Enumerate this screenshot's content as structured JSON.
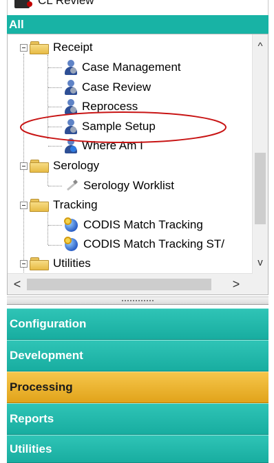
{
  "top_item": {
    "label": "CL Review"
  },
  "group_header": {
    "label": "All"
  },
  "tree": {
    "items": [
      {
        "label": "Receipt",
        "icon": "folder-icon"
      },
      {
        "label": "Case Management",
        "icon": "user-icon"
      },
      {
        "label": "Case Review",
        "icon": "user-icon"
      },
      {
        "label": "Reprocess",
        "icon": "user-icon"
      },
      {
        "label": "Sample Setup",
        "icon": "user-icon"
      },
      {
        "label": "Where Am I",
        "icon": "user-info-icon"
      },
      {
        "label": "Serology",
        "icon": "folder-icon"
      },
      {
        "label": "Serology Worklist",
        "icon": "syringe-icon"
      },
      {
        "label": "Tracking",
        "icon": "folder-icon"
      },
      {
        "label": "CODIS Match Tracking",
        "icon": "globe-search-icon"
      },
      {
        "label": "CODIS Match Tracking ST/",
        "icon": "globe-search-icon"
      },
      {
        "label": "Utilities",
        "icon": "folder-icon"
      }
    ]
  },
  "scrollbars": {
    "up": "^",
    "down": "v",
    "left": "<",
    "right": ">"
  },
  "nav_buttons": [
    {
      "label": "Configuration"
    },
    {
      "label": "Development"
    },
    {
      "label": "Processing",
      "active": true
    },
    {
      "label": "Reports"
    },
    {
      "label": "Utilities"
    }
  ],
  "colors": {
    "teal": "#18b3a5",
    "active_orange": "#e1a31a",
    "annotation_red": "#c81414"
  }
}
